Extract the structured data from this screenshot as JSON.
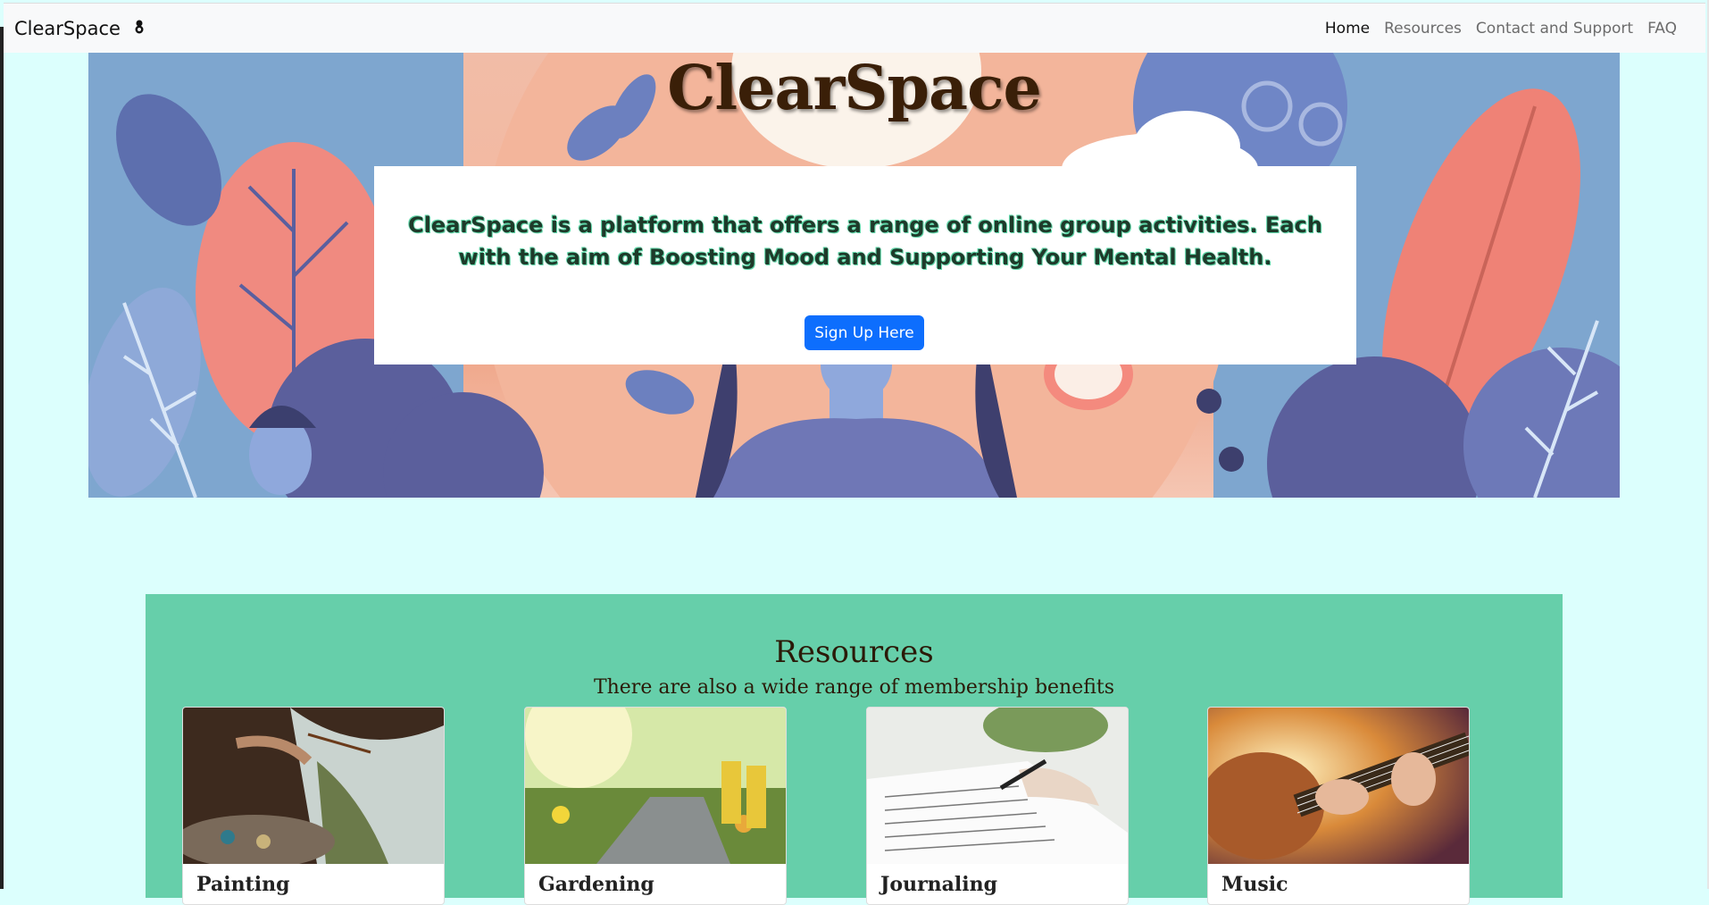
{
  "navbar": {
    "brand": "ClearSpace",
    "links": [
      {
        "label": "Home",
        "active": true
      },
      {
        "label": "Resources",
        "active": false
      },
      {
        "label": "Contact and Support",
        "active": false
      },
      {
        "label": "FAQ",
        "active": false
      }
    ]
  },
  "hero": {
    "title": "ClearSpace",
    "description": "ClearSpace is a platform that offers a range of online group activities. Each with the aim of Boosting Mood and Supporting Your Mental Health.",
    "signup_label": "Sign Up Here"
  },
  "resources": {
    "title": "Resources",
    "subtitle": "There are also a wide range of membership benefits",
    "cards": [
      {
        "title": "Painting"
      },
      {
        "title": "Gardening"
      },
      {
        "title": "Journaling"
      },
      {
        "title": "Music"
      }
    ]
  },
  "colors": {
    "background": "#dcfffd",
    "resources_bg": "#66cfaa",
    "primary_button": "#0d6efd"
  }
}
